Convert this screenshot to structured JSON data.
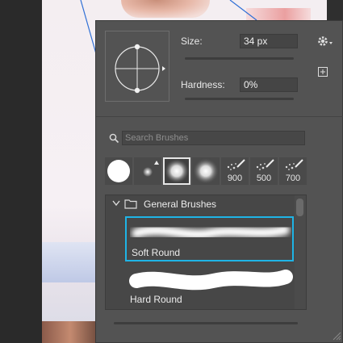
{
  "canvas": {
    "background": "#f4eef1",
    "guide_color": "#2f6fd6"
  },
  "brush_panel": {
    "size_label": "Size:",
    "size_value": "34 px",
    "hardness_label": "Hardness:",
    "hardness_value": "0%",
    "size_slider_fraction": 0.17,
    "hardness_slider_fraction": 0.0,
    "search_placeholder": "Search Brushes",
    "recent_tips": [
      {
        "kind": "hard-round",
        "number": ""
      },
      {
        "kind": "small-round",
        "number": ""
      },
      {
        "kind": "soft-round",
        "number": "",
        "selected": true
      },
      {
        "kind": "soft-round-large",
        "number": ""
      },
      {
        "kind": "scatter",
        "number": "900"
      },
      {
        "kind": "scatter",
        "number": "500"
      },
      {
        "kind": "scatter",
        "number": "700"
      }
    ],
    "group_name": "General Brushes",
    "brushes": [
      {
        "name": "Soft Round",
        "selected": true
      },
      {
        "name": "Hard Round",
        "selected": false
      }
    ],
    "bottom_slider_fraction": 0.34,
    "accent": "#1fb4e6"
  }
}
